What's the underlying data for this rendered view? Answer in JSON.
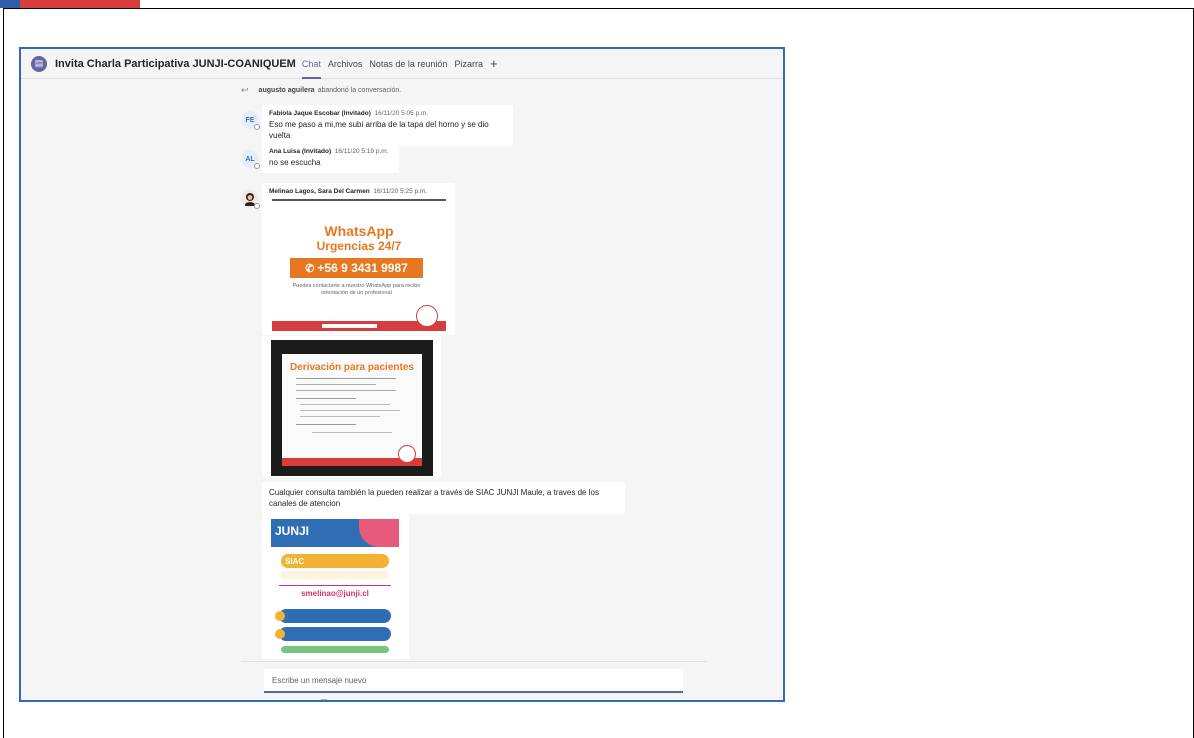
{
  "header": {
    "title": "Invita Charla Participativa JUNJI-COANIQUEM",
    "tabs": [
      "Chat",
      "Archivos",
      "Notas de la reunión",
      "Pizarra"
    ],
    "add_tab": "+"
  },
  "system_message": {
    "name": "augusto aguilera",
    "text": "abandonó la conversación."
  },
  "messages": [
    {
      "initials": "FE",
      "author": "Fabiola Jaque Escobar (Invitado)",
      "time": "16/11/20 5:05 p.m.",
      "text": "Eso me paso a mi,me subi arriba de la tapa del horno y se dio vuelta"
    },
    {
      "initials": "AL",
      "author": "Ana Luisa (Invitado)",
      "time": "16/11/20 5:19 p.m.",
      "text": "no se escucha"
    },
    {
      "initials": "",
      "author": "Melinao Lagos, Sara Del Carmen",
      "time": "16/11/20 5:25 p.m.",
      "text": "Cualquier consulta también la pueden realizar a través de SIAC JUNJI Maule, a traves de los canales de atencion"
    }
  ],
  "image1": {
    "title": "WhatsApp",
    "subtitle": "Urgencias 24/7",
    "phone": "+56 9 3431 9987",
    "body": "Puedes contactarte a nuestro WhatsApp para recibir orientación de un profesional"
  },
  "image2": {
    "title": "Derivación para pacientes"
  },
  "image3": {
    "logo": "JUNJI",
    "siac": "SIAC",
    "email": "smelinao@junji.cl"
  },
  "compose": {
    "placeholder": "Escribe un mensaje nuevo"
  },
  "colors": {
    "accent": "#6264a7",
    "whatsapp_orange": "#e87722",
    "brand_red": "#d83c3c",
    "frame_blue": "#3467b8"
  }
}
